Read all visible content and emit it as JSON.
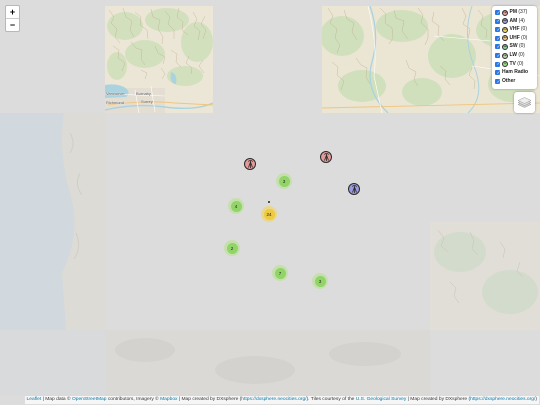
{
  "zoom": {
    "in_label": "+",
    "out_label": "−"
  },
  "legend": {
    "items": [
      {
        "code": "PM",
        "label": "PM",
        "count": " (37)",
        "checked": true,
        "color": "#e39a98"
      },
      {
        "code": "AM",
        "label": "AM",
        "count": " (4)",
        "checked": true,
        "color": "#9b99de"
      },
      {
        "code": "VHF",
        "label": "VHF",
        "count": " (0)",
        "checked": true,
        "color": "#ead56b"
      },
      {
        "code": "UHF",
        "label": "UHF",
        "count": " (0)",
        "checked": true,
        "color": "#ecc27a"
      },
      {
        "code": "SW",
        "label": "SW",
        "count": " (0)",
        "checked": true,
        "color": "#86cba0"
      },
      {
        "code": "LW",
        "label": "LW",
        "count": " (0)",
        "checked": true,
        "color": "#b4cfa6"
      },
      {
        "code": "TV",
        "label": "TV",
        "count": " (0)",
        "checked": true,
        "color": "#95da7f"
      },
      {
        "label": "Ham Radio",
        "checked": true
      },
      {
        "label": "Other",
        "checked": true
      }
    ]
  },
  "layers_control": {
    "icon": "layers-icon"
  },
  "map_labels": {
    "vancouver": "Vancouver",
    "burnaby": "Burnaby",
    "richmond": "Richmond",
    "surrey": "Surrey"
  },
  "markers": {
    "towers": [
      {
        "type": "PM",
        "color": "#e39a98"
      },
      {
        "type": "PM",
        "color": "#e39a98"
      },
      {
        "type": "AM",
        "color": "#9b99de"
      }
    ],
    "clusters": [
      {
        "count": "3",
        "level": "small"
      },
      {
        "count": "4",
        "level": "small"
      },
      {
        "count": "24",
        "level": "medium"
      },
      {
        "count": "2",
        "level": "small"
      },
      {
        "count": "7",
        "level": "small"
      },
      {
        "count": "3",
        "level": "small"
      }
    ]
  },
  "attribution": {
    "leaflet": "Leaflet",
    "t1": " | Map data © ",
    "osm": "OpenStreetMap",
    "t2": " contributors, Imagery © ",
    "mapbox": "Mapbox",
    "t3": " | Map created by DXsphere (",
    "url1": "https://dxsphere.neocities.org/",
    "t4": "). Tiles courtesy of the ",
    "usgs": "U.S. Geological Survey",
    "t5": " | Map created by DXsphere (",
    "url2": "https://dxsphere.neocities.org/",
    "t6": ")"
  },
  "colors": {
    "map_background": "#dcdcdc",
    "link": "#0078a8",
    "checkbox": "#2b78e4",
    "cluster_small": "#6ecc39",
    "cluster_medium": "#f0c20c"
  }
}
